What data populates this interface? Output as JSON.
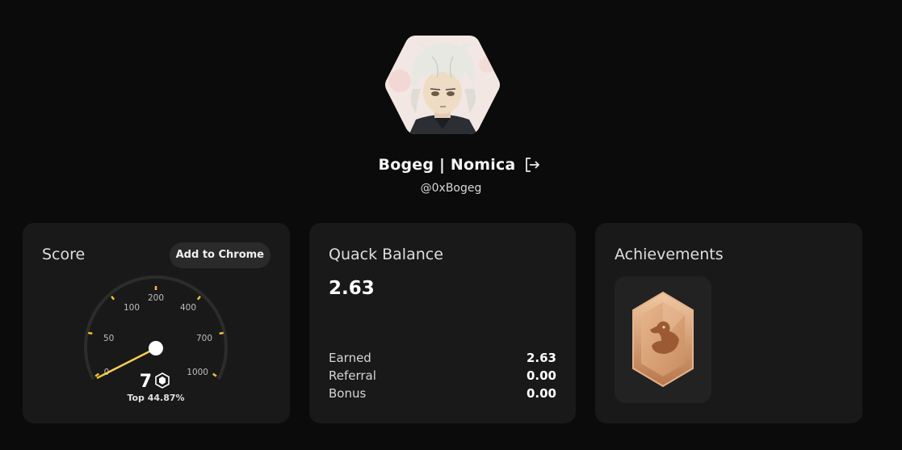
{
  "profile": {
    "display_name": "Bogeg | Nomica",
    "handle": "@0xBogeg",
    "avatar_icon": "anime-avatar-icon",
    "logout_icon": "logout-icon"
  },
  "score_card": {
    "title": "Score",
    "add_to_chrome_label": "Add to Chrome",
    "gauge_ticks": [
      "0",
      "50",
      "100",
      "200",
      "400",
      "700",
      "1000"
    ],
    "score_value": "7",
    "score_icon": "score-badge-icon",
    "rank_text": "Top 44.87%",
    "accent_color": "#f2c037"
  },
  "quack_card": {
    "title": "Quack Balance",
    "balance": "2.63",
    "rows": [
      {
        "label": "Earned",
        "value": "2.63"
      },
      {
        "label": "Referral",
        "value": "0.00"
      },
      {
        "label": "Bonus",
        "value": "0.00"
      }
    ]
  },
  "achievements_card": {
    "title": "Achievements",
    "badges": [
      {
        "icon": "bronze-duck-badge-icon",
        "color": "#c98d62"
      }
    ]
  }
}
